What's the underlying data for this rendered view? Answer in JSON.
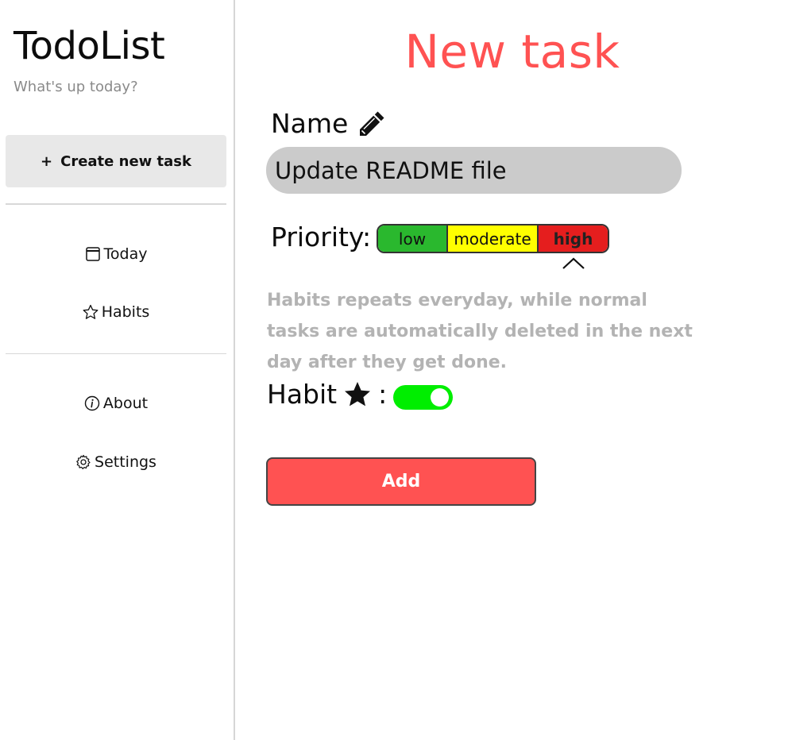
{
  "sidebar": {
    "title": "TodoList",
    "subtitle": "What's up today?",
    "create_label": "Create new task",
    "create_icon": "+",
    "nav": {
      "today": "Today",
      "habits": "Habits",
      "about": "About",
      "settings": "Settings"
    }
  },
  "main": {
    "title": "New task",
    "name_label": "Name",
    "name_value": "Update README file",
    "priority_label": "Priority:",
    "priority_options": [
      "low",
      "moderate",
      "high"
    ],
    "priority_selected": "high",
    "hint": "Habits repeats everyday, while normal tasks are automatically deleted in the next day after they get done.",
    "habit_label": "Habit",
    "habit_colon": ":",
    "habit_enabled": true,
    "add_label": "Add"
  },
  "colors": {
    "accent": "#ff5252",
    "low": "#2ab82e",
    "moderate": "#ffff00",
    "high": "#e51e1e",
    "toggle_on": "#00ee00"
  }
}
